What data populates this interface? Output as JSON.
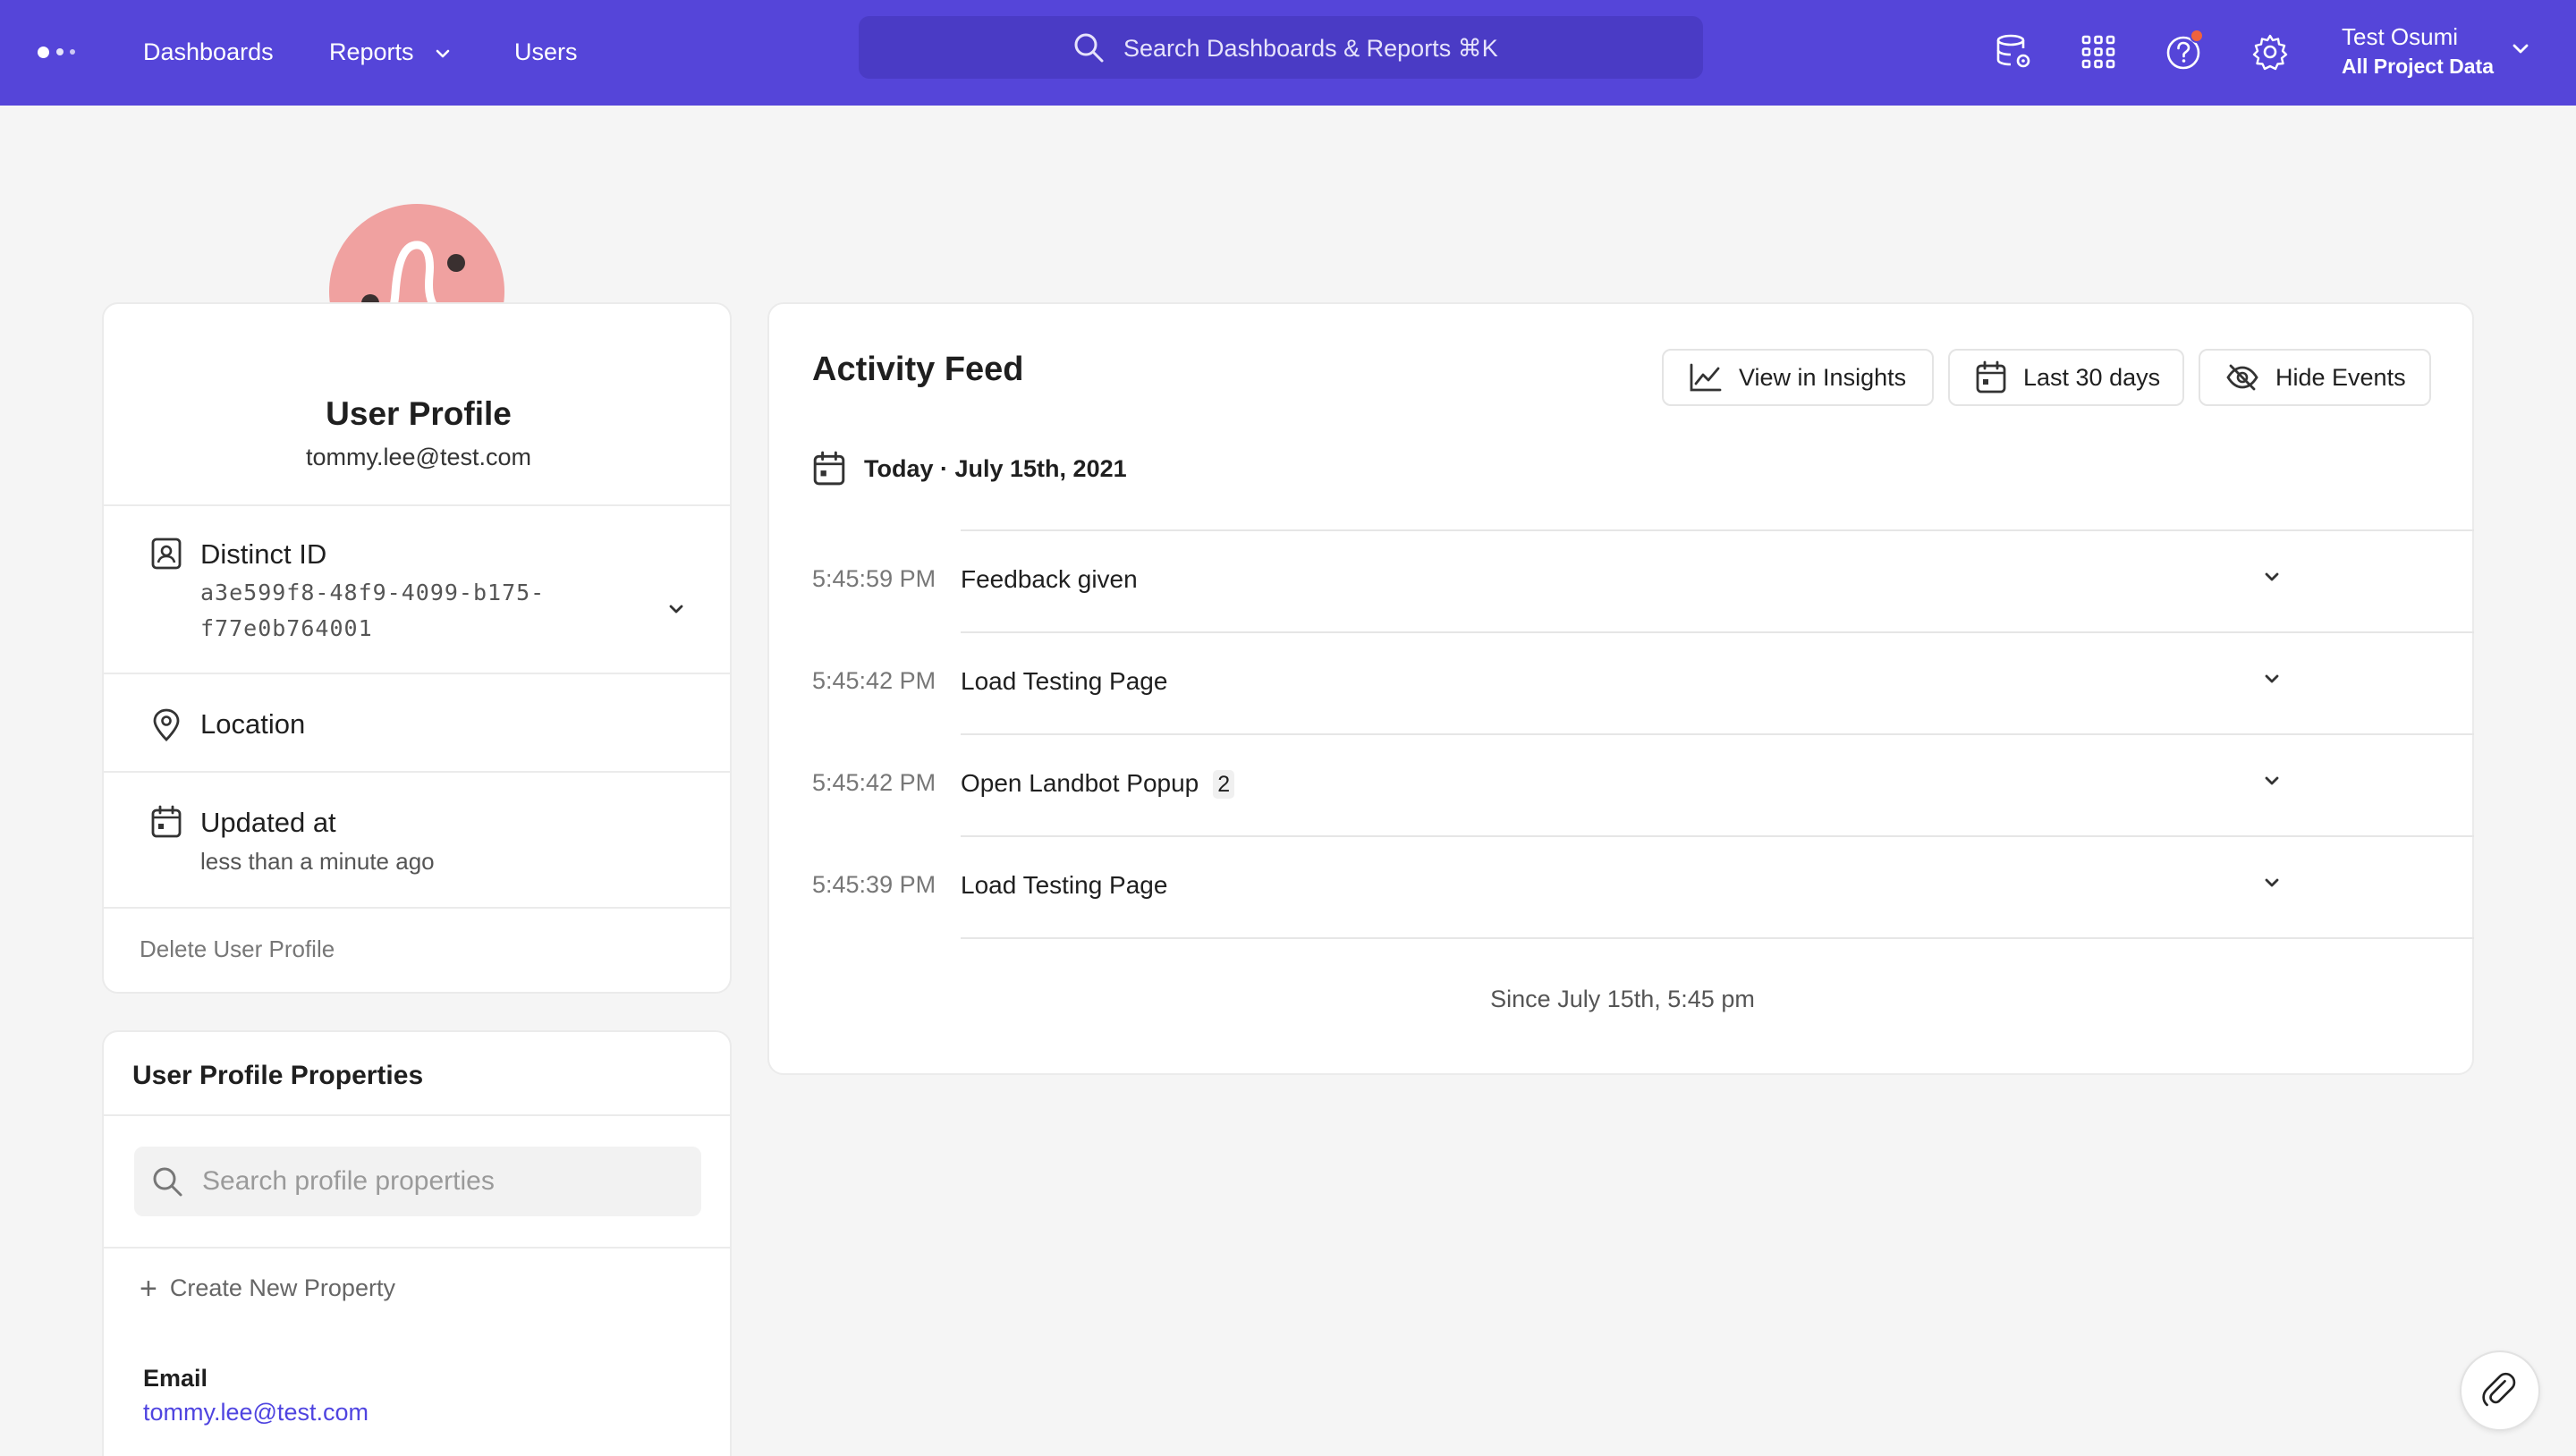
{
  "topbar": {
    "nav": [
      {
        "label": "Dashboards"
      },
      {
        "label": "Reports"
      },
      {
        "label": "Users"
      }
    ],
    "search_text": "Search Dashboards & Reports ⌘K",
    "icons": [
      "data-settings-icon",
      "apps-grid-icon",
      "help-icon",
      "gear-icon"
    ],
    "account": {
      "name": "Test Osumi",
      "project": "All Project Data"
    }
  },
  "profile": {
    "title": "User Profile",
    "email": "tommy.lee@test.com",
    "distinct_id_label": "Distinct ID",
    "distinct_id_line1": "a3e599f8-48f9-4099-b175-",
    "distinct_id_line2": "f77e0b764001",
    "location_label": "Location",
    "updated_label": "Updated at",
    "updated_value": "less than a minute ago",
    "delete_label": "Delete User Profile"
  },
  "properties": {
    "title": "User Profile Properties",
    "search_placeholder": "Search profile properties",
    "create_label": "Create New Property",
    "items": [
      {
        "key": "Email",
        "value": "tommy.lee@test.com"
      }
    ]
  },
  "feed": {
    "title": "Activity Feed",
    "buttons": {
      "insights": "View in Insights",
      "range": "Last 30 days",
      "hide": "Hide Events"
    },
    "date_heading": "Today · July 15th, 2021",
    "events": [
      {
        "time": "5:45:59 PM",
        "name": "Feedback given",
        "count": ""
      },
      {
        "time": "5:45:42 PM",
        "name": "Load Testing Page",
        "count": ""
      },
      {
        "time": "5:45:42 PM",
        "name": "Open Landbot Popup",
        "count": "2"
      },
      {
        "time": "5:45:39 PM",
        "name": "Load Testing Page",
        "count": ""
      }
    ],
    "footer": "Since July 15th, 5:45 pm"
  },
  "colors": {
    "brand": "#5545d9",
    "avatar": "#f0a1a0",
    "link": "#4f44e0",
    "notification": "#f0623c"
  }
}
